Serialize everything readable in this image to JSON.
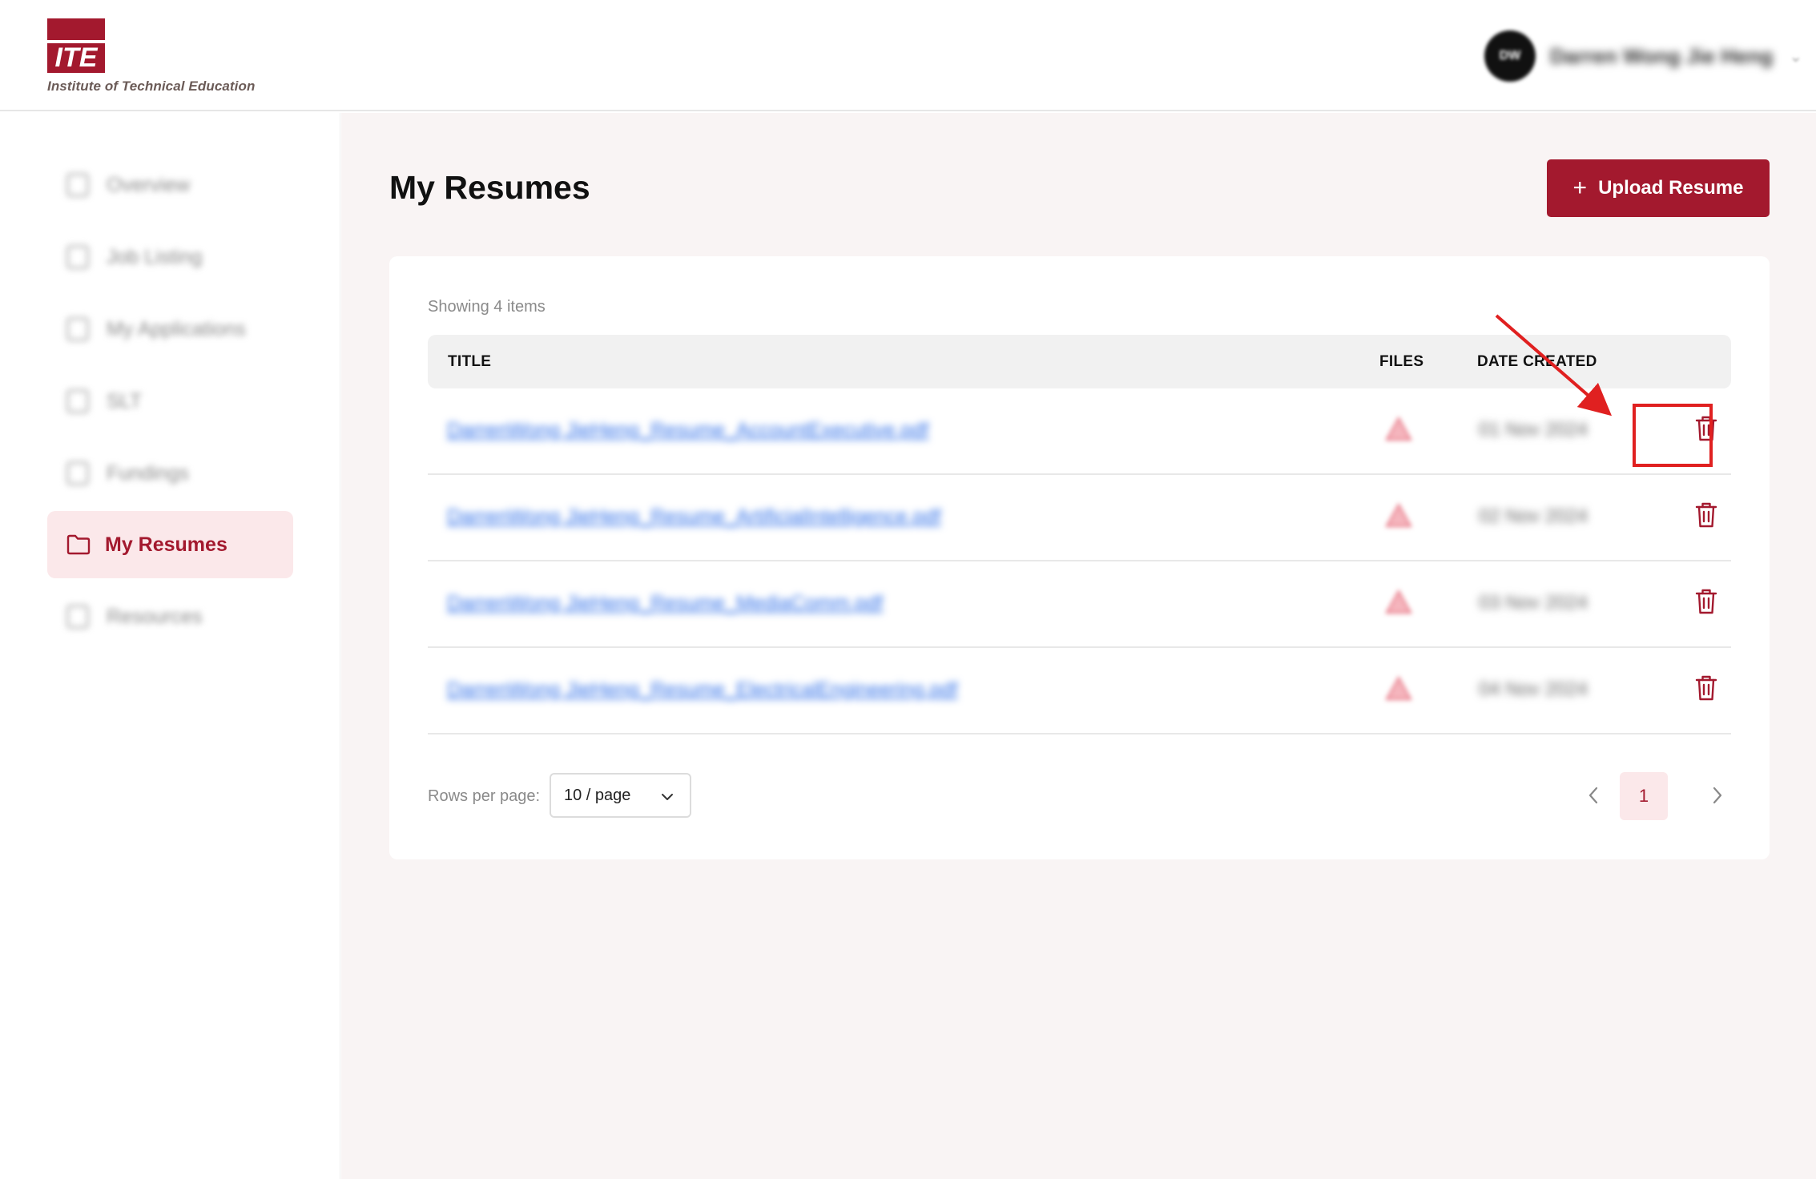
{
  "header": {
    "logo_text": "ITE",
    "logo_caption": "Institute of Technical Education",
    "user": {
      "initials": "DW",
      "name": "Darren Wong Jie Heng"
    }
  },
  "colors": {
    "brand": "#a3192e",
    "active_bg": "#fbe8ea",
    "link": "#2f6fe8",
    "annotation": "#e02020",
    "main_bg": "#f9f4f4"
  },
  "sidebar": {
    "items": [
      {
        "label": "Overview",
        "icon": "dashboard-icon"
      },
      {
        "label": "Job Listing",
        "icon": "briefcase-icon"
      },
      {
        "label": "My Applications",
        "icon": "document-icon"
      },
      {
        "label": "SLT",
        "icon": "clipboard-icon"
      },
      {
        "label": "Fundings",
        "icon": "money-icon"
      },
      {
        "label": "My Resumes",
        "icon": "folder-icon",
        "active": true
      },
      {
        "label": "Resources",
        "icon": "book-icon"
      }
    ]
  },
  "main": {
    "title": "My Resumes",
    "upload_button": "Upload Resume",
    "showing_text": "Showing 4 items",
    "table": {
      "columns": [
        "TITLE",
        "FILES",
        "DATE CREATED"
      ],
      "rows": [
        {
          "title": "DarrenWong JieHeng_Resume_AccountExecutive.pdf",
          "date": "01 Nov 2024"
        },
        {
          "title": "DarrenWong JieHeng_Resume_ArtificialIntelligence.pdf",
          "date": "02 Nov 2024"
        },
        {
          "title": "DarrenWong JieHeng_Resume_MediaComm.pdf",
          "date": "03 Nov 2024"
        },
        {
          "title": "DarrenWong JieHeng_Resume_ElectricalEngineering.pdf",
          "date": "04 Nov 2024"
        }
      ]
    },
    "pagination": {
      "rows_per_page_label": "Rows per page:",
      "rows_per_page_value": "10 / page",
      "current_page": "1"
    }
  }
}
